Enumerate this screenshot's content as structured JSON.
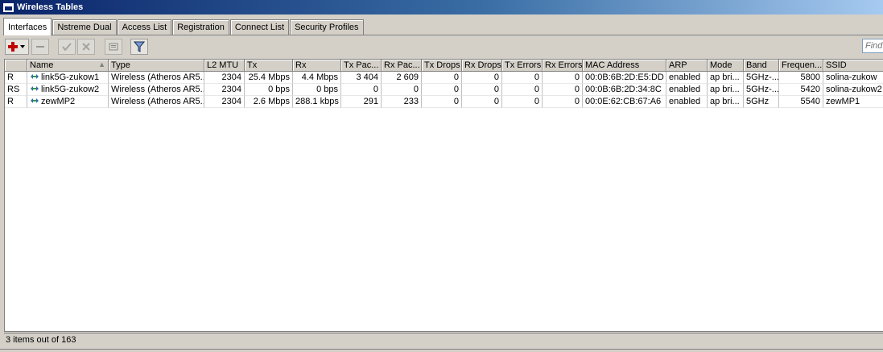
{
  "window": {
    "title": "Wireless Tables"
  },
  "tabs": [
    {
      "label": "Interfaces",
      "active": true
    },
    {
      "label": "Nstreme Dual"
    },
    {
      "label": "Access List"
    },
    {
      "label": "Registration"
    },
    {
      "label": "Connect List"
    },
    {
      "label": "Security Profiles"
    }
  ],
  "toolbar": {
    "icons": [
      "add-menu-icon",
      "remove-icon",
      "enable-icon",
      "disable-icon",
      "comment-icon",
      "filter-icon"
    ],
    "accent_add": "#c00000"
  },
  "search": {
    "placeholder": "Find"
  },
  "table": {
    "columns": [
      "",
      "Name",
      "Type",
      "L2 MTU",
      "Tx",
      "Rx",
      "Tx Pac...",
      "Rx Pac...",
      "Tx Drops",
      "Rx Drops",
      "Tx Errors",
      "Rx Errors",
      "MAC Address",
      "ARP",
      "Mode",
      "Band",
      "Frequen...",
      "SSID"
    ],
    "rows": [
      [
        "R",
        "link5G-zukow1",
        "Wireless (Atheros AR5...",
        "2304",
        "25.4 Mbps",
        "4.4 Mbps",
        "3 404",
        "2 609",
        "0",
        "0",
        "0",
        "0",
        "00:0B:6B:2D:E5:DD",
        "enabled",
        "ap bri...",
        "5GHz-...",
        "5800",
        "solina-zukow"
      ],
      [
        "RS",
        "link5G-zukow2",
        "Wireless (Atheros AR5...",
        "2304",
        "0 bps",
        "0 bps",
        "0",
        "0",
        "0",
        "0",
        "0",
        "0",
        "00:0B:6B:2D:34:8C",
        "enabled",
        "ap bri...",
        "5GHz-...",
        "5420",
        "solina-zukow2"
      ],
      [
        "R",
        "zewMP2",
        "Wireless (Atheros AR5...",
        "2304",
        "2.6 Mbps",
        "288.1 kbps",
        "291",
        "233",
        "0",
        "0",
        "0",
        "0",
        "00:0E:62:CB:67:A6",
        "enabled",
        "ap bri...",
        "5GHz",
        "5540",
        "zewMP1"
      ]
    ]
  },
  "status": {
    "text": "3 items out of 163"
  }
}
